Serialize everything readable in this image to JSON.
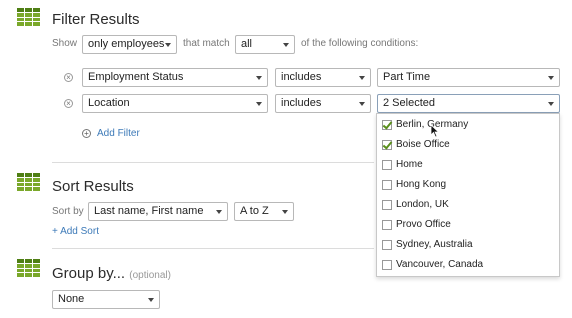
{
  "filter": {
    "title": "Filter Results",
    "show_label": "Show",
    "show_value": "only employees",
    "that_match_label": "that match",
    "match_value": "all",
    "conditions_label": "of the following conditions:",
    "rows": [
      {
        "field": "Employment Status",
        "operator": "includes",
        "value": "Part Time"
      },
      {
        "field": "Location",
        "operator": "includes",
        "value": "2 Selected"
      }
    ],
    "remove_icon": "×",
    "add_filter_label": "Add Filter",
    "add_icon": "+"
  },
  "dropdown": {
    "options": [
      {
        "label": "Berlin, Germany",
        "checked": true
      },
      {
        "label": "Boise Office",
        "checked": true
      },
      {
        "label": "Home",
        "checked": false
      },
      {
        "label": "Hong Kong",
        "checked": false
      },
      {
        "label": "London, UK",
        "checked": false
      },
      {
        "label": "Provo Office",
        "checked": false
      },
      {
        "label": "Sydney, Australia",
        "checked": false
      },
      {
        "label": "Vancouver, Canada",
        "checked": false
      }
    ]
  },
  "sort": {
    "title": "Sort Results",
    "sort_by_label": "Sort by",
    "field_value": "Last name, First name",
    "order_value": "A to Z",
    "add_sort_label": "+ Add Sort"
  },
  "group": {
    "title": "Group by...",
    "optional_label": "(optional)",
    "value": "None"
  },
  "colors": {
    "accent_green": "#7aa82a",
    "link_blue": "#3d7ab8"
  }
}
